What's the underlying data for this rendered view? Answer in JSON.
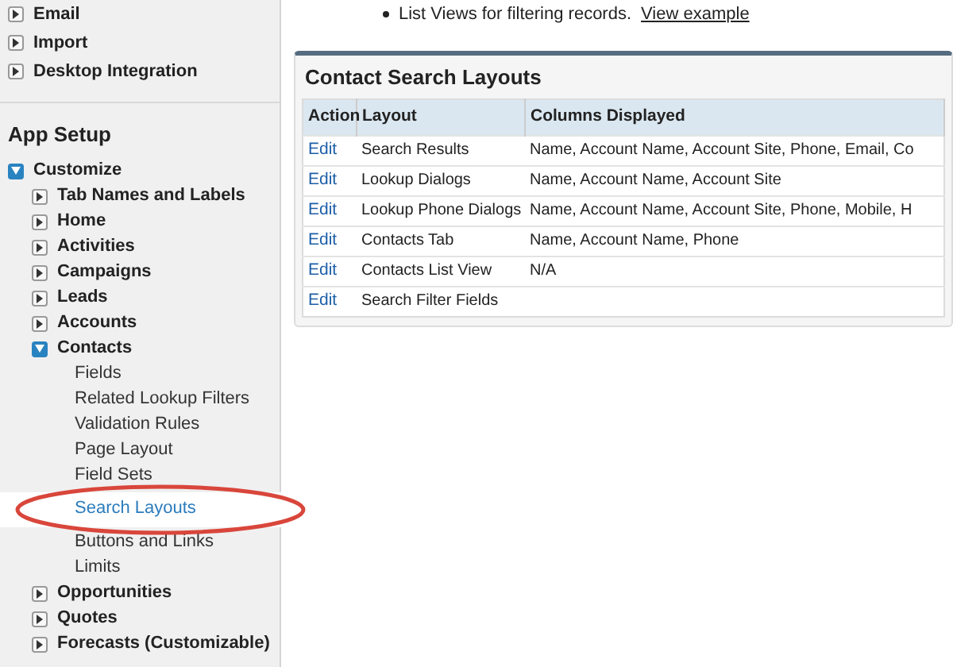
{
  "sidebar": {
    "top_items": [
      {
        "label": "Email",
        "expanded": false
      },
      {
        "label": "Import",
        "expanded": false
      },
      {
        "label": "Desktop Integration",
        "expanded": false
      }
    ],
    "section_title": "App Setup",
    "tree": [
      {
        "label": "Customize",
        "expanded": true,
        "children": [
          {
            "label": "Tab Names and Labels",
            "expanded": false
          },
          {
            "label": "Home",
            "expanded": false
          },
          {
            "label": "Activities",
            "expanded": false
          },
          {
            "label": "Campaigns",
            "expanded": false
          },
          {
            "label": "Leads",
            "expanded": false
          },
          {
            "label": "Accounts",
            "expanded": false
          },
          {
            "label": "Contacts",
            "expanded": true,
            "children": [
              {
                "label": "Fields",
                "selected": false
              },
              {
                "label": "Related Lookup Filters",
                "selected": false
              },
              {
                "label": "Validation Rules",
                "selected": false
              },
              {
                "label": "Page Layout",
                "selected": false
              },
              {
                "label": "Field Sets",
                "selected": false
              },
              {
                "label": "Search Layouts",
                "selected": true
              },
              {
                "label": "Buttons and Links",
                "selected": false
              },
              {
                "label": "Limits",
                "selected": false
              }
            ]
          },
          {
            "label": "Opportunities",
            "expanded": false
          },
          {
            "label": "Quotes",
            "expanded": false
          },
          {
            "label": "Forecasts (Customizable)",
            "expanded": false
          }
        ]
      }
    ]
  },
  "intro": {
    "bullet": "List Views for filtering records.",
    "link": "View example"
  },
  "panel": {
    "title": "Contact Search Layouts",
    "columns": [
      "Action",
      "Layout",
      "Columns Displayed"
    ],
    "rows": [
      {
        "action": "Edit",
        "layout": "Search Results",
        "columns_displayed": "Name, Account Name, Account Site, Phone, Email, Co"
      },
      {
        "action": "Edit",
        "layout": "Lookup Dialogs",
        "columns_displayed": "Name, Account Name, Account Site"
      },
      {
        "action": "Edit",
        "layout": "Lookup Phone Dialogs",
        "columns_displayed": "Name, Account Name, Account Site, Phone, Mobile, H"
      },
      {
        "action": "Edit",
        "layout": "Contacts Tab",
        "columns_displayed": "Name, Account Name, Phone"
      },
      {
        "action": "Edit",
        "layout": "Contacts List View",
        "columns_displayed": "N/A"
      },
      {
        "action": "Edit",
        "layout": "Search Filter Fields"
      }
    ]
  }
}
